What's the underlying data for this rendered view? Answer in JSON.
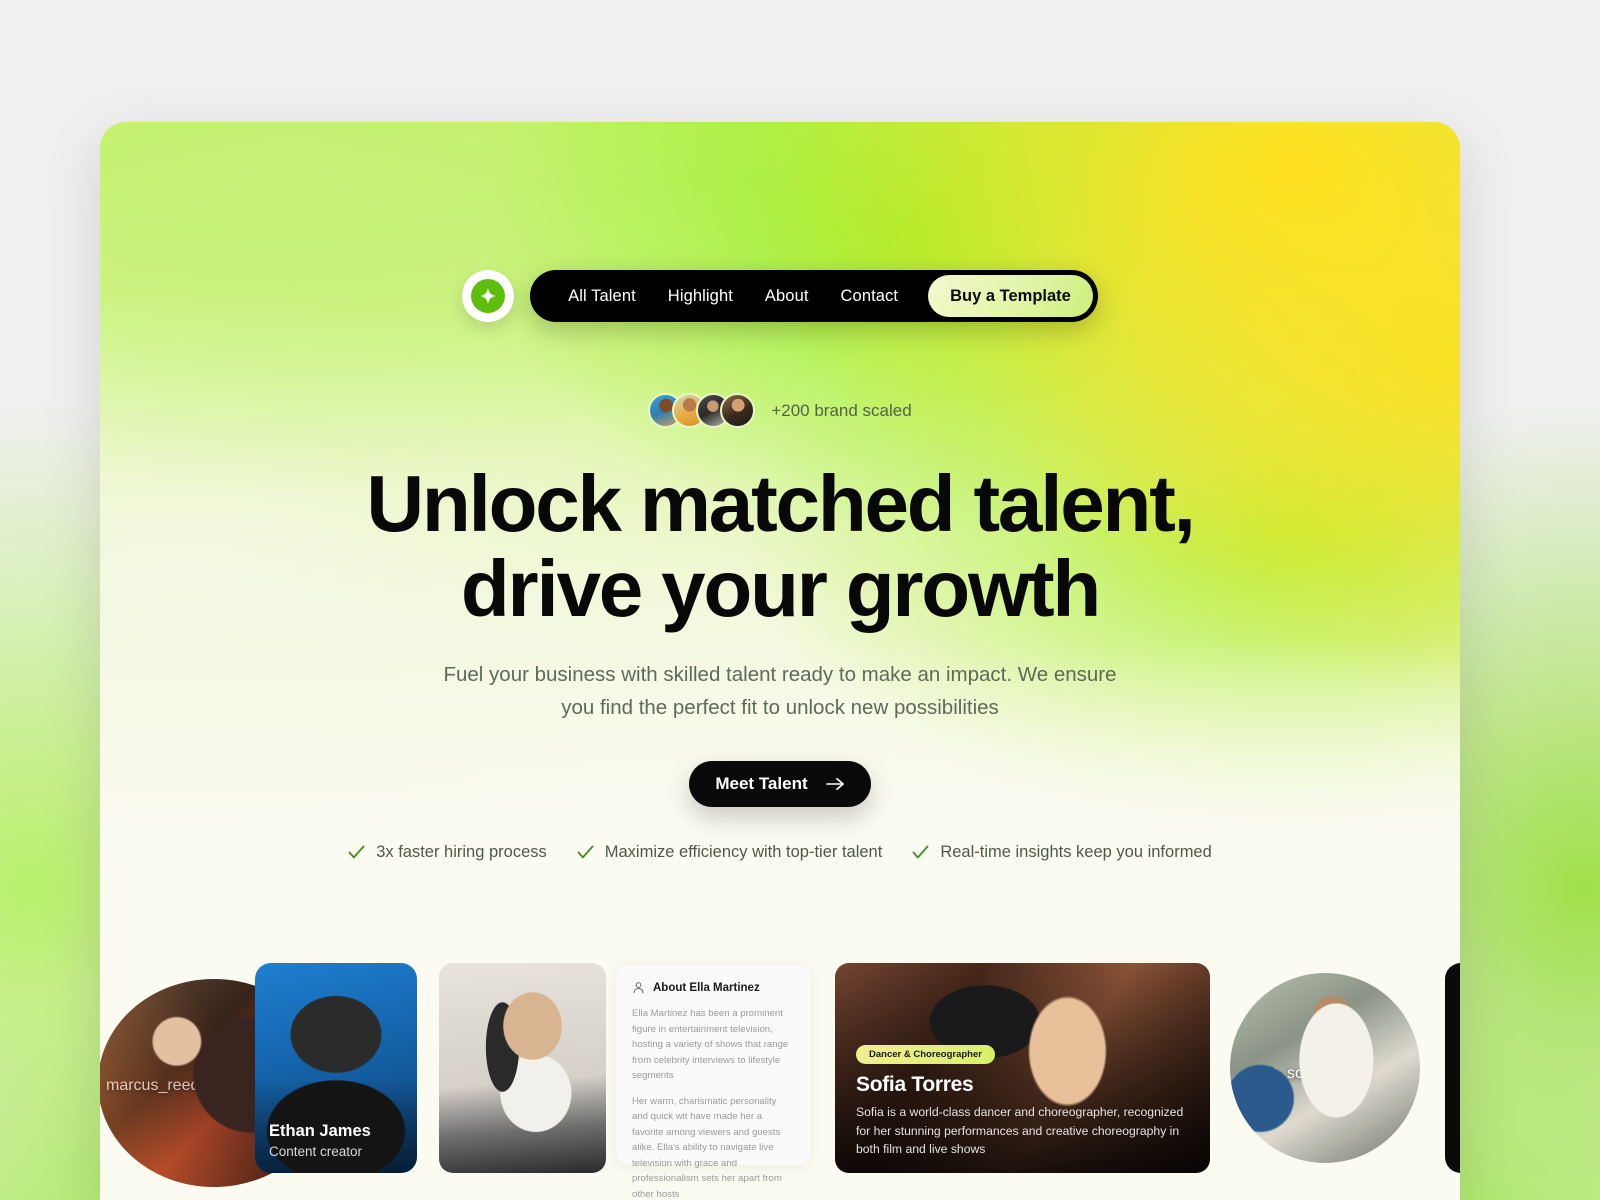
{
  "brand": {
    "logo_icon": "sparkle-icon",
    "accent_green": "#5fbd0d",
    "accent_lime": "#cdef7d",
    "hero_yellow": "#ffe01f"
  },
  "nav": {
    "links": [
      {
        "label": "All Talent"
      },
      {
        "label": "Highlight"
      },
      {
        "label": "About"
      },
      {
        "label": "Contact"
      }
    ],
    "cta_label": "Buy a Template"
  },
  "social_proof": {
    "text": "+200 brand scaled",
    "avatar_count": 4
  },
  "hero": {
    "headline_line1": "Unlock matched talent,",
    "headline_line2": "drive your growth",
    "subhead_line1": "Fuel your business with skilled talent ready to make an impact. We ensure",
    "subhead_line2": "you find the perfect fit to unlock new possibilities",
    "cta_label": "Meet Talent",
    "cta_icon": "arrow-right-icon"
  },
  "features": [
    {
      "icon": "check-icon",
      "label": "3x faster hiring process"
    },
    {
      "icon": "check-icon",
      "label": "Maximize efficiency with top-tier talent"
    },
    {
      "icon": "check-icon",
      "label": "Real-time insights keep you informed"
    }
  ],
  "showcase": {
    "marcus": {
      "username": "marcus_reed"
    },
    "ethan": {
      "name": "Ethan James",
      "role": "Content creator"
    },
    "ella": {
      "about_title": "About Ella Martinez",
      "about_icon": "person-icon",
      "paragraph1": "Ella Martinez has been a prominent figure in entertainment television, hosting a variety of shows that range from celebrity interviews to lifestyle segments",
      "paragraph2": "Her warm, charismatic personality and quick wit have made her a favorite among viewers and guests alike. Ella's ability to navigate live television with grace and professionalism sets her apart from other hosts"
    },
    "sofia": {
      "badge": "Dancer & Choreographer",
      "name": "Sofia Torres",
      "description": "Sofia is a world-class dancer and choreographer, recognized for her stunning performances and creative choreography in both film and live shows"
    },
    "sofia_circle": {
      "username": "sofia_torres",
      "icon": "tiktok-icon"
    }
  }
}
